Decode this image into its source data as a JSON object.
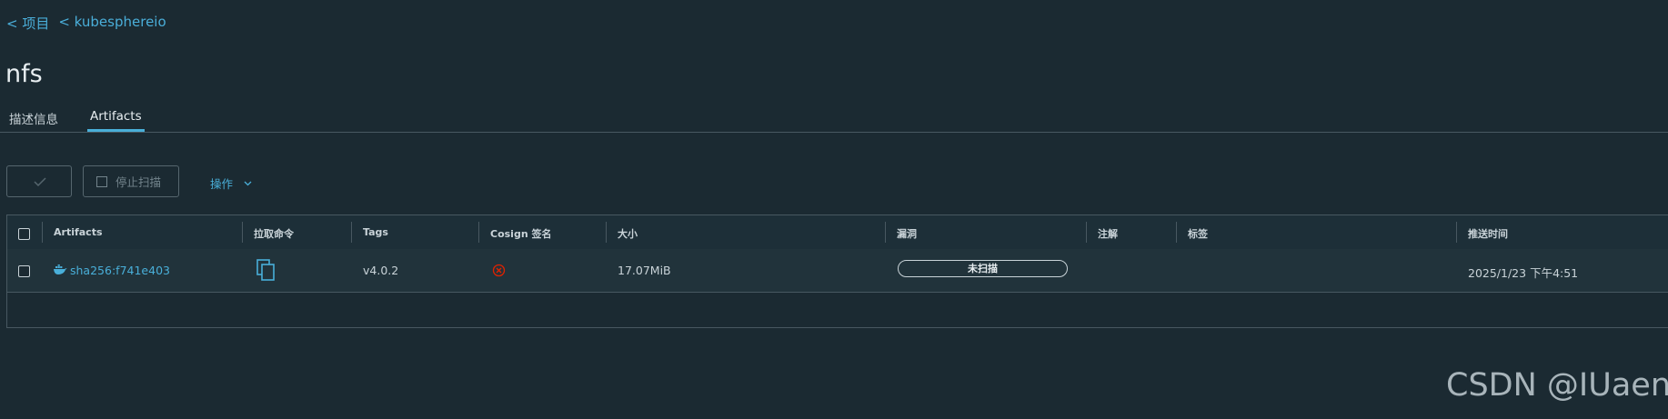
{
  "breadcrumb": {
    "items": [
      "< 项目",
      "< kubesphereio"
    ]
  },
  "page_title": "nfs",
  "tabs": [
    {
      "label": "描述信息",
      "active": false
    },
    {
      "label": "Artifacts",
      "active": true
    }
  ],
  "toolbar": {
    "scan_icon": "check-icon",
    "stop_scan_label": "停止扫描",
    "action_label": "操作"
  },
  "table": {
    "columns": [
      "Artifacts",
      "拉取命令",
      "Tags",
      "Cosign 签名",
      "大小",
      "漏洞",
      "注解",
      "标签",
      "推送时间"
    ],
    "rows": [
      {
        "artifact": "sha256:f741e403",
        "pull_command_icon": "copy-icon",
        "tags": "v4.0.2",
        "cosign_icon": "unsigned-x-circle-icon",
        "size": "17.07MiB",
        "vulnerability": "未扫描",
        "annotations": "",
        "labels": "",
        "push_time": "2025/1/23 下午4:51"
      }
    ]
  },
  "watermark": "CSDN @IUaena",
  "colors": {
    "background": "#1b2a32",
    "accent": "#49afd9",
    "border": "#485861",
    "text": "#c9d3d8",
    "error": "#e12200"
  }
}
